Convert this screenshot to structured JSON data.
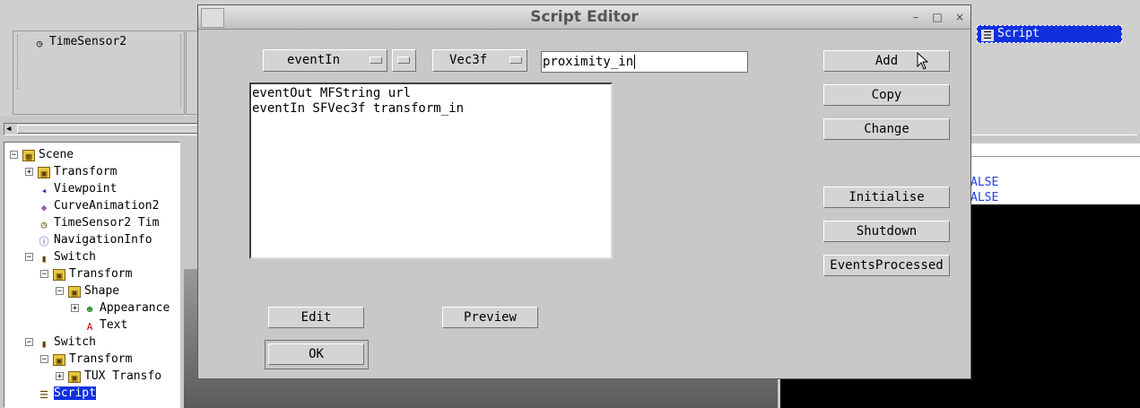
{
  "background": {
    "top_panel_item": "TimeSensor2",
    "tree": [
      {
        "label": "Scene",
        "icon": "scene-icon",
        "level": 0,
        "expander": "minus"
      },
      {
        "label": "Transform",
        "icon": "transform-icon",
        "level": 1,
        "expander": "plus"
      },
      {
        "label": "Viewpoint",
        "icon": "viewpoint-icon",
        "level": 1,
        "expander": ""
      },
      {
        "label": "CurveAnimation2",
        "icon": "curve-animation-icon",
        "level": 1,
        "expander": ""
      },
      {
        "label": "TimeSensor2 Tim",
        "icon": "timesensor-icon",
        "level": 1,
        "expander": ""
      },
      {
        "label": "NavigationInfo",
        "icon": "navigation-info-icon",
        "level": 1,
        "expander": ""
      },
      {
        "label": "Switch",
        "icon": "switch-icon",
        "level": 1,
        "expander": "minus"
      },
      {
        "label": "Transform",
        "icon": "transform-icon",
        "level": 2,
        "expander": "minus"
      },
      {
        "label": "Shape",
        "icon": "shape-icon",
        "level": 3,
        "expander": "minus"
      },
      {
        "label": "Appearance",
        "icon": "appearance-icon",
        "level": 4,
        "expander": "plus"
      },
      {
        "label": "Text",
        "icon": "text-icon",
        "level": 4,
        "expander": ""
      },
      {
        "label": "Switch",
        "icon": "switch-icon",
        "level": 1,
        "expander": "minus"
      },
      {
        "label": "Transform",
        "icon": "transform-icon",
        "level": 2,
        "expander": "minus"
      },
      {
        "label": "TUX Transfo",
        "icon": "transform-icon",
        "level": 3,
        "expander": "plus"
      },
      {
        "label": "Script",
        "icon": "script-icon",
        "level": 1,
        "expander": "",
        "selected": true
      }
    ],
    "right_tab_label": "Script",
    "field_values": [
      "ALSE",
      "ALSE"
    ]
  },
  "dialog": {
    "title": "Script Editor",
    "window_buttons": {
      "minimize": "–",
      "maximize": "□",
      "close": "×"
    },
    "event_type": "eventIn",
    "field_type": "Vec3f",
    "name_value": "proximity_in",
    "fields": [
      "eventOut MFString url",
      "eventIn SFVec3f transform_in"
    ],
    "buttons": {
      "add": "Add",
      "copy": "Copy",
      "change": "Change",
      "initialise": "Initialise",
      "shutdown": "Shutdown",
      "events_processed": "EventsProcessed",
      "edit": "Edit",
      "preview": "Preview",
      "ok": "OK"
    }
  },
  "colors": {
    "selection": "#1030e0",
    "field_value": "#2040e0"
  }
}
